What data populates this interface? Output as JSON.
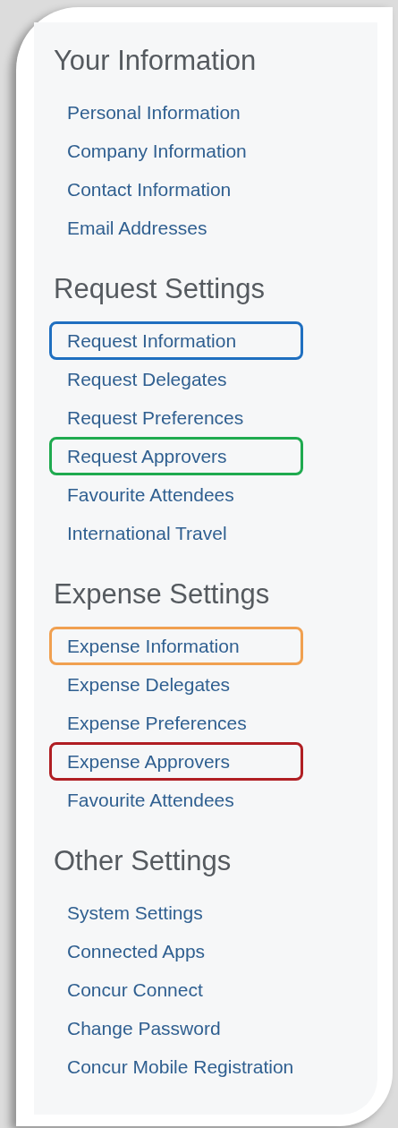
{
  "sections": [
    {
      "title": "Your Information",
      "links": [
        {
          "label": "Personal Information"
        },
        {
          "label": "Company Information"
        },
        {
          "label": "Contact Information"
        },
        {
          "label": "Email Addresses"
        }
      ]
    },
    {
      "title": "Request Settings",
      "links": [
        {
          "label": "Request Information",
          "color": "#1f6fc0"
        },
        {
          "label": "Request Delegates"
        },
        {
          "label": "Request Preferences"
        },
        {
          "label": "Request Approvers",
          "color": "#1faa4f"
        },
        {
          "label": "Favourite Attendees"
        },
        {
          "label": "International Travel"
        }
      ]
    },
    {
      "title": "Expense Settings",
      "links": [
        {
          "label": "Expense Information",
          "color": "#f0a050"
        },
        {
          "label": "Expense Delegates"
        },
        {
          "label": "Expense Preferences"
        },
        {
          "label": "Expense Approvers",
          "color": "#b01e23"
        },
        {
          "label": "Favourite Attendees"
        }
      ]
    },
    {
      "title": "Other Settings",
      "links": [
        {
          "label": "System Settings"
        },
        {
          "label": "Connected Apps"
        },
        {
          "label": "Concur Connect"
        },
        {
          "label": "Change Password"
        },
        {
          "label": "Concur Mobile Registration"
        }
      ]
    }
  ]
}
